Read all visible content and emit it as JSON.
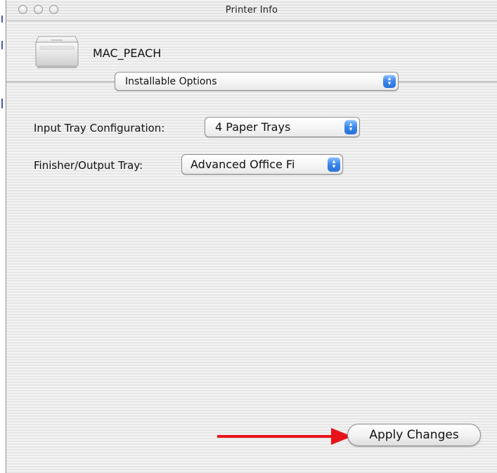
{
  "window": {
    "title": "Printer Info"
  },
  "printer": {
    "name": "MAC_PEACH"
  },
  "section_popup": {
    "selected": "Installable Options"
  },
  "options": [
    {
      "label": "Input Tray Configuration:",
      "selected": "4 Paper Trays"
    },
    {
      "label": "Finisher/Output Tray:",
      "selected": "Advanced Office Fi"
    }
  ],
  "buttons": {
    "apply_label": "Apply Changes"
  },
  "icons": {
    "popup_arrows": "up-down-arrows-icon",
    "printer": "printer-icon",
    "annotation": "red-arrow-icon"
  },
  "colors": {
    "popup_arrow_blue": "#3a86ea",
    "annotation_red": "#e8141a"
  }
}
